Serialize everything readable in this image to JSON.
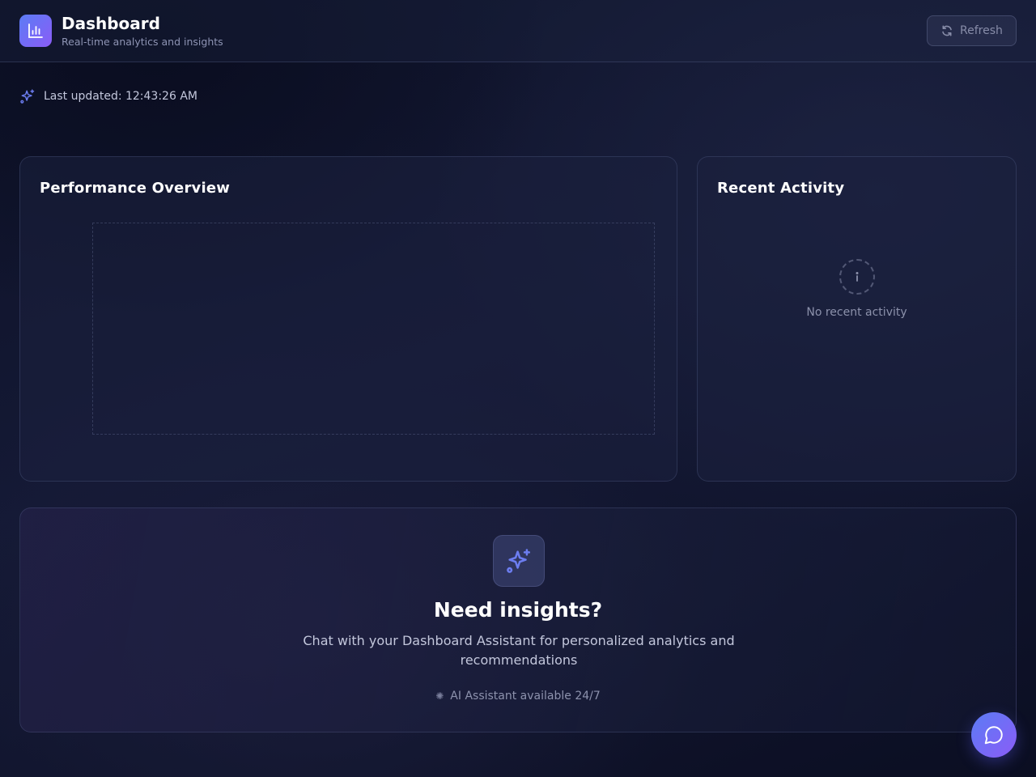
{
  "header": {
    "title": "Dashboard",
    "subtitle": "Real-time analytics and insights",
    "logo_icon": "bar-chart-icon",
    "refresh_label": "Refresh",
    "refresh_icon": "refresh-icon"
  },
  "status": {
    "last_updated": "Last updated: 12:43:26 AM",
    "icon": "sparkles-icon"
  },
  "performance": {
    "title": "Performance Overview"
  },
  "recent_activity": {
    "title": "Recent Activity",
    "empty_text": "No recent activity",
    "empty_icon": "info-icon"
  },
  "insights": {
    "icon": "sparkles-icon",
    "title": "Need insights?",
    "description": "Chat with your Dashboard Assistant for personalized analytics and recommendations",
    "status_text": "AI Assistant available 24/7"
  },
  "chat_button": {
    "icon": "chat-bubble-icon"
  },
  "colors": {
    "accent_start": "#5b7cf5",
    "accent_end": "#8b5cf6",
    "background": "#0e1228"
  }
}
